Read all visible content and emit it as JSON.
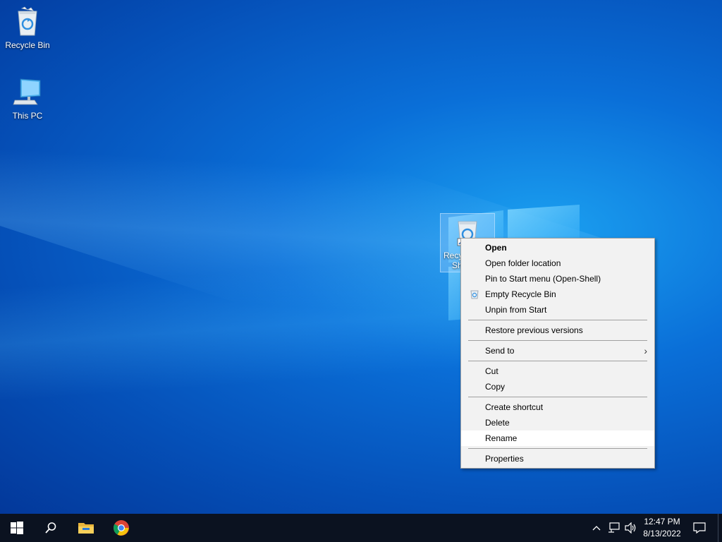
{
  "desktop": {
    "icons": [
      {
        "label": "Recycle Bin",
        "icon": "recycle-bin-icon"
      },
      {
        "label": "This PC",
        "icon": "this-pc-icon"
      },
      {
        "label_line1": "Recyc",
        "label_line2": "Sh",
        "icon": "recycle-bin-shortcut-icon",
        "selected": true
      }
    ]
  },
  "context_menu": {
    "items": [
      {
        "label": "Open"
      },
      {
        "label": "Open folder location"
      },
      {
        "label": "Pin to Start menu (Open-Shell)"
      },
      {
        "label": "Empty Recycle Bin",
        "icon": "recycle-bin-small-icon"
      },
      {
        "label": "Unpin from Start"
      },
      {
        "label": "Restore previous versions"
      },
      {
        "label": "Send to",
        "submenu": true
      },
      {
        "label": "Cut"
      },
      {
        "label": "Copy"
      },
      {
        "label": "Create shortcut"
      },
      {
        "label": "Delete"
      },
      {
        "label": "Rename",
        "highlighted": true
      },
      {
        "label": "Properties"
      }
    ]
  },
  "taskbar": {
    "buttons": [
      {
        "icon": "windows-start-icon"
      },
      {
        "icon": "search-icon"
      },
      {
        "icon": "file-explorer-icon"
      },
      {
        "icon": "chrome-icon"
      }
    ],
    "tray": {
      "icons": [
        "chevron-up-icon",
        "network-icon",
        "volume-icon",
        "notification-icon"
      ],
      "time": "12:47 PM",
      "date": "8/13/2022"
    }
  },
  "colors": {
    "taskbar_bg": "#0b1220",
    "menu_bg": "#f2f2f2",
    "menu_highlight": "#ffffff",
    "desktop_accent": "#0a6fd8"
  }
}
